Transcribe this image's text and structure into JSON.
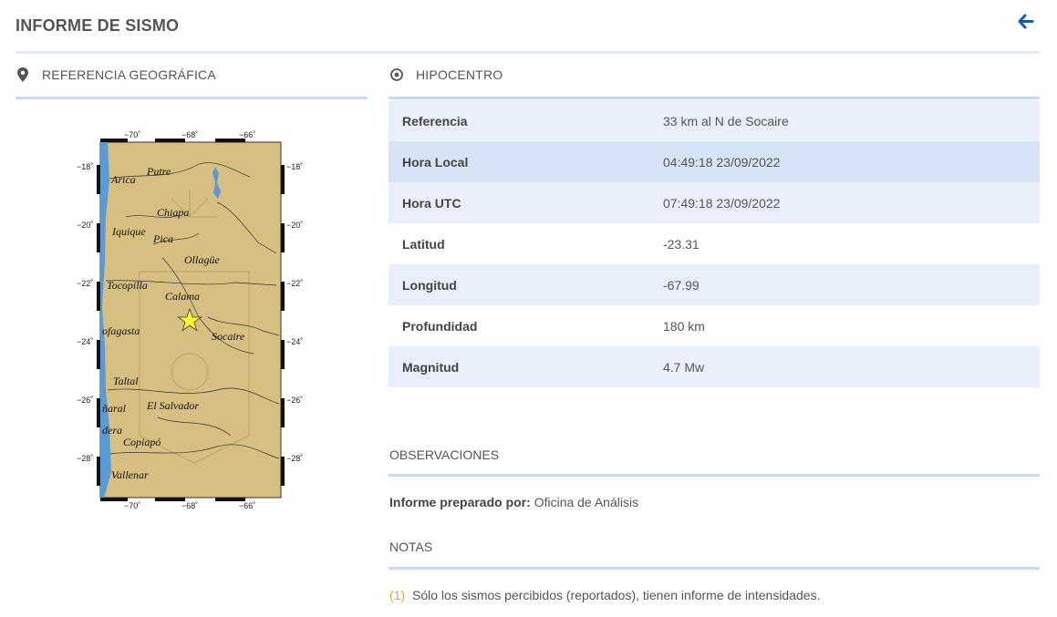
{
  "header": {
    "title": "INFORME DE SISMO",
    "back_icon": "arrow-left-icon"
  },
  "geo_section": {
    "title": "REFERENCIA GEOGRÁFICA",
    "icon": "map-pin-icon"
  },
  "map": {
    "top_ticks": [
      "−70˚",
      "−68˚",
      "−66˚"
    ],
    "bottom_ticks": [
      "−70˚",
      "−68˚",
      "−66˚"
    ],
    "left_ticks": [
      "−18˚",
      "−20˚",
      "−22˚",
      "−24˚",
      "−26˚",
      "−28˚"
    ],
    "right_ticks": [
      "−18˚",
      "−20˚",
      "−22˚",
      "−24˚",
      "−26˚",
      "−28˚"
    ],
    "places": [
      "Putre",
      "Arica",
      "Chiapa",
      "Iquique",
      "Pica",
      "Ollagüe",
      "Tocopilla",
      "Calama",
      "ofagasta",
      "Socaire",
      "Taltal",
      "El Salvador",
      "ñaral",
      "dera",
      "Copiapó",
      "Vallenar"
    ],
    "epicenter_icon": "star-icon",
    "colors": {
      "land": "#d6bf80",
      "sea": "#5b9bd5"
    }
  },
  "hypo_section": {
    "title": "HIPOCENTRO",
    "icon": "target-icon"
  },
  "hypo_rows": [
    {
      "label": "Referencia",
      "value": "33 km al N de Socaire"
    },
    {
      "label": "Hora Local",
      "value": "04:49:18 23/09/2022"
    },
    {
      "label": "Hora UTC",
      "value": "07:49:18 23/09/2022"
    },
    {
      "label": "Latitud",
      "value": "-23.31"
    },
    {
      "label": "Longitud",
      "value": "-67.99"
    },
    {
      "label": "Profundidad",
      "value": "180 km"
    },
    {
      "label": "Magnitud",
      "value": "4.7 Mw"
    }
  ],
  "observations": {
    "title": "OBSERVACIONES",
    "prepared_label": "Informe preparado por:",
    "prepared_value": "Oficina de Análisis"
  },
  "notes": {
    "title": "NOTAS",
    "items": [
      {
        "number": "(1)",
        "text": "Sólo los sismos percibidos (reportados), tienen informe de intensidades."
      }
    ]
  },
  "colors": {
    "accent": "#1a56b8",
    "rule": "#c9d9f0",
    "row_alt": "#e9f0fb",
    "row_highlight": "#d6e4f7",
    "note_number": "#e8a33d"
  }
}
